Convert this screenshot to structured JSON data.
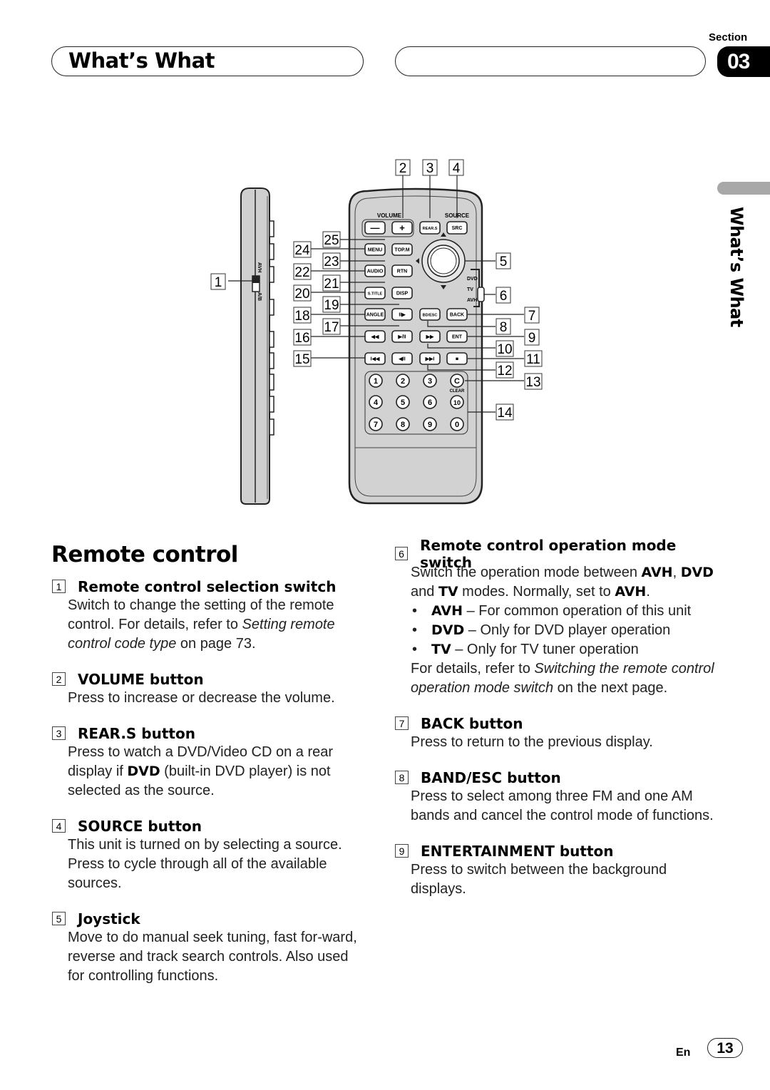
{
  "header": {
    "title": "What’s What",
    "section_label": "Section",
    "section_number": "03",
    "side_tab_text": "What’s What"
  },
  "diagram": {
    "callouts": [
      "1",
      "2",
      "3",
      "4",
      "5",
      "6",
      "7",
      "8",
      "9",
      "10",
      "11",
      "12",
      "13",
      "14",
      "15",
      "16",
      "17",
      "18",
      "19",
      "20",
      "21",
      "22",
      "23",
      "24",
      "25"
    ],
    "side_switch_labels": [
      "AVH",
      "A/B"
    ],
    "mode_switch_labels": [
      "DVD",
      "TV",
      "AVH"
    ],
    "buttons": {
      "volume_label": "VOLUME",
      "source_label": "SOURCE",
      "minus": "—",
      "plus": "+",
      "rears": "REAR.S",
      "src": "SRC",
      "menu": "MENU",
      "topm": "TOP.M",
      "audio": "AUDIO",
      "rtn": "RTN",
      "stitle": "S.TITLE",
      "disp": "DISP",
      "angle": "ANGLE",
      "step_fwd": "II▶",
      "bandesc": "BD/ESC",
      "back": "BACK",
      "rew": "◀◀",
      "play_pause": "▶/II",
      "ffwd": "▶▶",
      "ent": "ENT",
      "prev": "I◀◀",
      "step_back": "◀II",
      "next": "▶▶I",
      "stop": "■",
      "clear_key": "C",
      "clear_label": "CLEAR",
      "numpad": [
        "1",
        "2",
        "3",
        "4",
        "5",
        "6",
        "10",
        "7",
        "8",
        "9",
        "0"
      ]
    }
  },
  "main": {
    "heading": "Remote control",
    "left_items": [
      {
        "num": "1",
        "title": "Remote control selection switch",
        "body_html": "Switch to change the setting of the remote control. For details, refer to <i>Setting remote control code type</i> on page 73."
      },
      {
        "num": "2",
        "title": "VOLUME button",
        "body_html": "Press to increase or decrease the volume."
      },
      {
        "num": "3",
        "title": "REAR.S button",
        "body_html": "Press to watch a DVD/Video CD on a rear display if <b>DVD</b> (built-in DVD player) is not selected as the source."
      },
      {
        "num": "4",
        "title": "SOURCE button",
        "body_html": "This unit is turned on by selecting a source. Press to cycle through all of the available sources."
      },
      {
        "num": "5",
        "title": "Joystick",
        "body_html": "Move to do manual seek tuning, fast for-ward, reverse and track search controls. Also used for controlling functions."
      }
    ],
    "right_items": [
      {
        "num": "6",
        "title": "Remote control operation mode switch",
        "body_html": "Switch the operation mode between <b>AVH</b>, <b>DVD</b> and <b>TV</b> modes. Normally, set to <b>AVH</b>.<ul class=\"bullets\"><li><b>AVH</b> – For common operation of this unit</li><li><b>DVD</b> – Only for DVD player operation</li><li><b>TV</b> – Only for TV tuner operation</li></ul>For details, refer to <i>Switching the remote control operation mode switch</i> on the next page."
      },
      {
        "num": "7",
        "title": "BACK button",
        "body_html": "Press to return to the previous display."
      },
      {
        "num": "8",
        "title": "BAND/ESC button",
        "body_html": "Press to select among three FM and one AM bands and cancel the control mode of functions."
      },
      {
        "num": "9",
        "title": "ENTERTAINMENT button",
        "body_html": "Press to switch between the background displays."
      }
    ]
  },
  "footer": {
    "language": "En",
    "page_number": "13"
  }
}
